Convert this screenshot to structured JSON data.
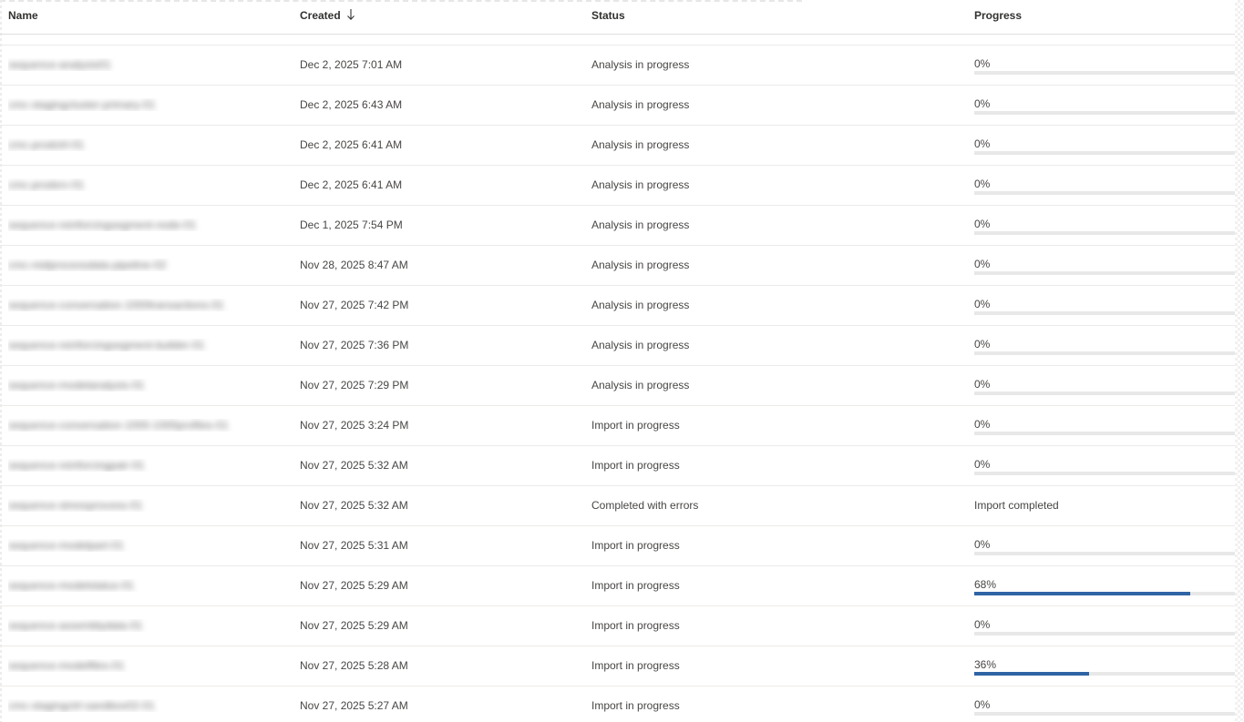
{
  "columns": {
    "name": "Name",
    "created": "Created",
    "status": "Status",
    "progress": "Progress"
  },
  "sort": {
    "column": "created",
    "direction": "descending",
    "icon": "arrow-down-icon"
  },
  "colors": {
    "progress_fill": "#2f64a5",
    "progress_track": "#e8e8e8"
  },
  "rows": [
    {
      "name": "sequence-analysis01",
      "created": "Dec 2, 2025 7:01 AM",
      "status": "Analysis in progress",
      "progress_text": "0%",
      "progress": 0
    },
    {
      "name": "cmc-stagingcluster-primary-01",
      "created": "Dec 2, 2025 6:43 AM",
      "status": "Analysis in progress",
      "progress_text": "0%",
      "progress": 0
    },
    {
      "name": "cmc-prodctrl-01",
      "created": "Dec 2, 2025 6:41 AM",
      "status": "Analysis in progress",
      "progress_text": "0%",
      "progress": 0
    },
    {
      "name": "cmc-prodsrv-01",
      "created": "Dec 2, 2025 6:41 AM",
      "status": "Analysis in progress",
      "progress_text": "0%",
      "progress": 0
    },
    {
      "name": "sequence-reinforcingsegment-node-01",
      "created": "Dec 1, 2025 7:54 PM",
      "status": "Analysis in progress",
      "progress_text": "0%",
      "progress": 0
    },
    {
      "name": "cmc-midprocessdata-pipeline-02",
      "created": "Nov 28, 2025 8:47 AM",
      "status": "Analysis in progress",
      "progress_text": "0%",
      "progress": 0
    },
    {
      "name": "sequence-conversation-1000transactions-01",
      "created": "Nov 27, 2025 7:42 PM",
      "status": "Analysis in progress",
      "progress_text": "0%",
      "progress": 0
    },
    {
      "name": "sequence-reinforcingsegment-builder-01",
      "created": "Nov 27, 2025 7:36 PM",
      "status": "Analysis in progress",
      "progress_text": "0%",
      "progress": 0
    },
    {
      "name": "sequence-modelanalysis-01",
      "created": "Nov 27, 2025 7:29 PM",
      "status": "Analysis in progress",
      "progress_text": "0%",
      "progress": 0
    },
    {
      "name": "sequence-conversation-1000-1000profiles-01",
      "created": "Nov 27, 2025 3:24 PM",
      "status": "Import in progress",
      "progress_text": "0%",
      "progress": 0
    },
    {
      "name": "sequence-reinforcingpair-01",
      "created": "Nov 27, 2025 5:32 AM",
      "status": "Import in progress",
      "progress_text": "0%",
      "progress": 0
    },
    {
      "name": "sequence-stressprocess-01",
      "created": "Nov 27, 2025 5:32 AM",
      "status": "Completed with errors",
      "progress_text": "Import completed",
      "progress": null
    },
    {
      "name": "sequence-modelpart-01",
      "created": "Nov 27, 2025 5:31 AM",
      "status": "Import in progress",
      "progress_text": "0%",
      "progress": 0
    },
    {
      "name": "sequence-modelstatus-01",
      "created": "Nov 27, 2025 5:29 AM",
      "status": "Import in progress",
      "progress_text": "68%",
      "progress": 0.83
    },
    {
      "name": "sequence-assemblydata-01",
      "created": "Nov 27, 2025 5:29 AM",
      "status": "Import in progress",
      "progress_text": "0%",
      "progress": 0
    },
    {
      "name": "sequence-modelfiles-01",
      "created": "Nov 27, 2025 5:28 AM",
      "status": "Import in progress",
      "progress_text": "36%",
      "progress": 0.44
    },
    {
      "name": "cmc-stagingctrl-sandbox02-01",
      "created": "Nov 27, 2025 5:27 AM",
      "status": "Import in progress",
      "progress_text": "0%",
      "progress": 0
    }
  ]
}
